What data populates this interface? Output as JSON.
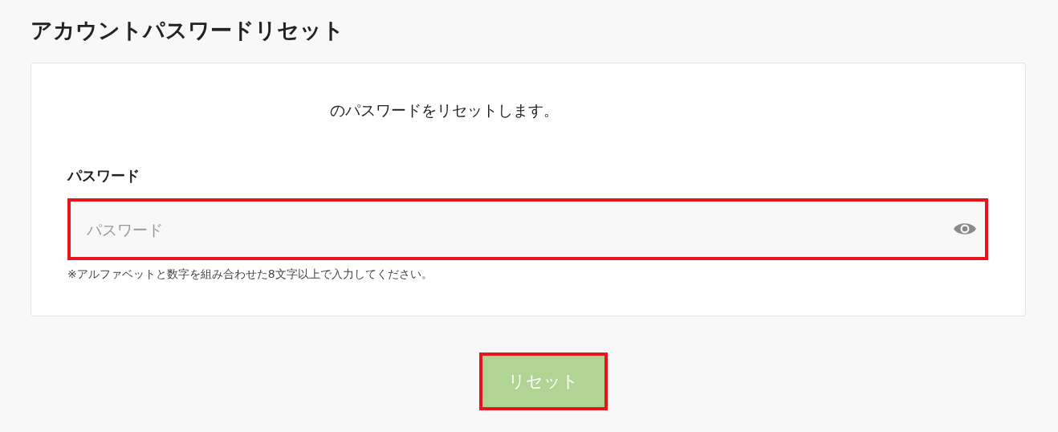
{
  "page": {
    "title": "アカウントパスワードリセット"
  },
  "card": {
    "message": "のパスワードをリセットします。",
    "password": {
      "label": "パスワード",
      "placeholder": "パスワード",
      "highlighted": true,
      "hint": "※アルファベットと数字を組み合わせた8文字以上で入力してください。"
    }
  },
  "reset_button": {
    "label": "リセット",
    "highlighted": true,
    "disabled": true
  }
}
